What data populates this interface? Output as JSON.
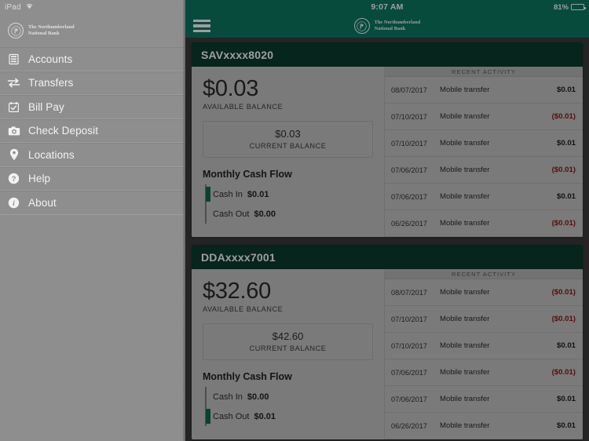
{
  "device": {
    "status_left_label": "iPad",
    "wifi_icon": "wifi-icon",
    "clock": "9:07 AM",
    "battery_percent": "81%",
    "battery_icon": "battery-icon"
  },
  "brand": {
    "logo_icon": "bank-seal-icon",
    "name_line1": "The Northumberland",
    "name_line2": "National Bank",
    "teal": "#0c7a61",
    "dark_teal": "#0a3d2e"
  },
  "topbar": {
    "menu_icon": "hamburger-menu-icon"
  },
  "sidebar": {
    "items": [
      {
        "label": "Accounts",
        "icon": "accounts-stack-icon"
      },
      {
        "label": "Transfers",
        "icon": "transfer-arrows-icon"
      },
      {
        "label": "Bill Pay",
        "icon": "calendar-check-icon"
      },
      {
        "label": "Check Deposit",
        "icon": "camera-icon"
      },
      {
        "label": "Locations",
        "icon": "map-pin-icon"
      },
      {
        "label": "Help",
        "icon": "question-circle-icon"
      },
      {
        "label": "About",
        "icon": "info-circle-icon"
      }
    ]
  },
  "labels": {
    "available_balance": "AVAILABLE BALANCE",
    "current_balance": "CURRENT BALANCE",
    "monthly_cash_flow": "Monthly Cash Flow",
    "cash_in": "Cash In",
    "cash_out": "Cash Out",
    "recent_activity": "RECENT ACTIVITY"
  },
  "accounts": [
    {
      "title": "SAVxxxx8020",
      "available_balance": "$0.03",
      "current_balance": "$0.03",
      "cash_in": "$0.01",
      "cash_out": "$0.00",
      "cash_in_filled": true,
      "cash_out_filled": false,
      "transactions": [
        {
          "date": "08/07/2017",
          "description": "Mobile transfer",
          "amount": "$0.01",
          "negative": false
        },
        {
          "date": "07/10/2017",
          "description": "Mobile transfer",
          "amount": "($0.01)",
          "negative": true
        },
        {
          "date": "07/10/2017",
          "description": "Mobile transfer",
          "amount": "$0.01",
          "negative": false
        },
        {
          "date": "07/06/2017",
          "description": "Mobile transfer",
          "amount": "($0.01)",
          "negative": true
        },
        {
          "date": "07/06/2017",
          "description": "Mobile transfer",
          "amount": "$0.01",
          "negative": false
        },
        {
          "date": "06/26/2017",
          "description": "Mobile transfer",
          "amount": "($0.01)",
          "negative": true
        }
      ]
    },
    {
      "title": "DDAxxxx7001",
      "available_balance": "$32.60",
      "current_balance": "$42.60",
      "cash_in": "$0.00",
      "cash_out": "$0.01",
      "cash_in_filled": false,
      "cash_out_filled": true,
      "transactions": [
        {
          "date": "08/07/2017",
          "description": "Mobile transfer",
          "amount": "($0.01)",
          "negative": true
        },
        {
          "date": "07/10/2017",
          "description": "Mobile transfer",
          "amount": "($0.01)",
          "negative": true
        },
        {
          "date": "07/10/2017",
          "description": "Mobile transfer",
          "amount": "$0.01",
          "negative": false
        },
        {
          "date": "07/06/2017",
          "description": "Mobile transfer",
          "amount": "($0.01)",
          "negative": true
        },
        {
          "date": "07/06/2017",
          "description": "Mobile transfer",
          "amount": "$0.01",
          "negative": false
        },
        {
          "date": "06/26/2017",
          "description": "Mobile transfer",
          "amount": "$0.01",
          "negative": false
        }
      ]
    }
  ]
}
